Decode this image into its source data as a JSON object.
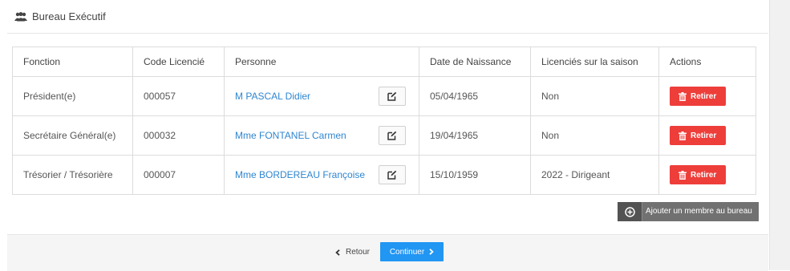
{
  "panel": {
    "title": "Bureau Exécutif"
  },
  "table": {
    "headers": [
      "Fonction",
      "Code Licencié",
      "Personne",
      "Date de Naissance",
      "Licenciés sur la saison",
      "Actions"
    ],
    "rows": [
      {
        "fonction": "Président(e)",
        "code": "000057",
        "personne": "M PASCAL Didier",
        "naissance": "05/04/1965",
        "saison": "Non",
        "action": "Retirer"
      },
      {
        "fonction": "Secrétaire Général(e)",
        "code": "000032",
        "personne": "Mme FONTANEL Carmen",
        "naissance": "19/04/1965",
        "saison": "Non",
        "action": "Retirer"
      },
      {
        "fonction": "Trésorier / Trésorière",
        "code": "000007",
        "personne": "Mme BORDEREAU Françoise",
        "naissance": "15/10/1959",
        "saison": "2022 - Dirigeant",
        "action": "Retirer"
      }
    ]
  },
  "add_member_label": "Ajouter un membre au bureau",
  "footer": {
    "back_label": "Retour",
    "continue_label": "Continuer"
  },
  "colors": {
    "link": "#2f86d0",
    "danger": "#ee3e3a",
    "primary": "#2196f3",
    "dark_button": "#717171"
  },
  "icons": {
    "panel": "users-icon",
    "edit": "edit-icon",
    "remove": "trash-icon",
    "add": "plus-circle-icon",
    "back": "chevron-left-icon",
    "next": "chevron-right-icon"
  }
}
